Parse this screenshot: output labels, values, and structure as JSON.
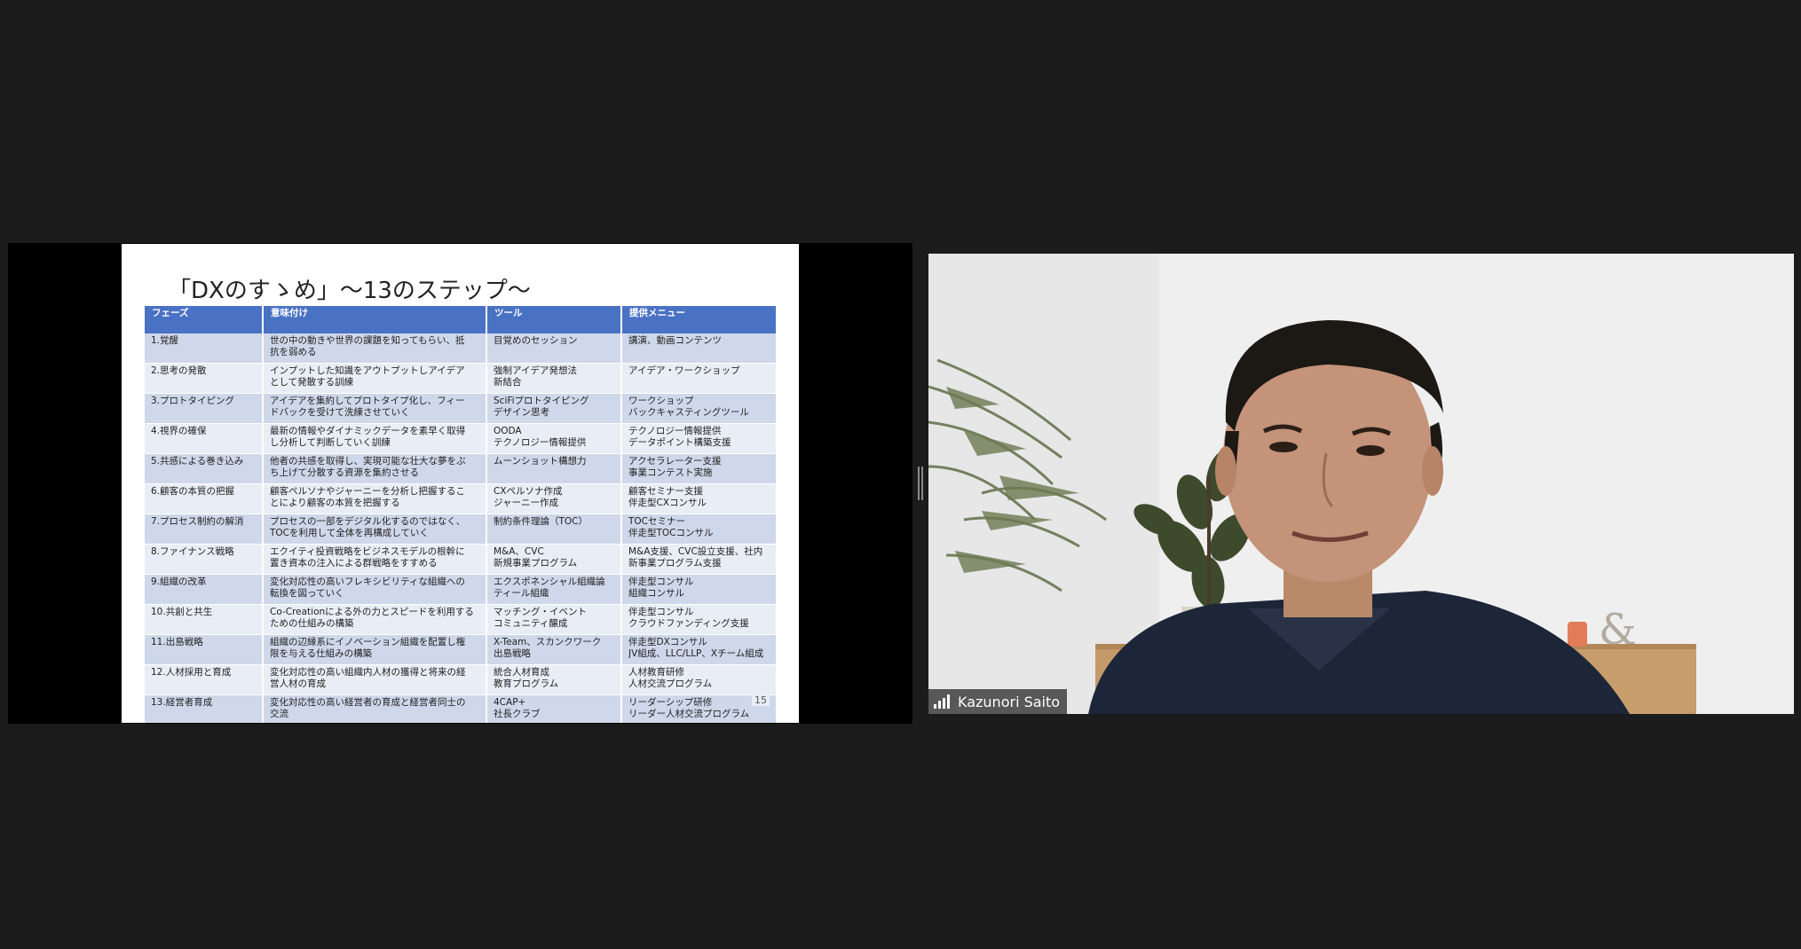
{
  "slide": {
    "title": "「DXのすゝめ」〜13のステップ〜",
    "headers": [
      "フェーズ",
      "意味付け",
      "ツール",
      "提供メニュー"
    ],
    "rows": [
      [
        [
          "1.覚醒"
        ],
        [
          "世の中の動きや世界の課題を知ってもらい、抵",
          "抗を弱める"
        ],
        [
          "目覚めのセッション"
        ],
        [
          "講演、動画コンテンツ"
        ]
      ],
      [
        [
          "2.思考の発散"
        ],
        [
          "インプットした知識をアウトプットしアイデア",
          "として発散する訓練"
        ],
        [
          "強制アイデア発想法",
          "新結合"
        ],
        [
          "アイデア・ワークショップ"
        ]
      ],
      [
        [
          "3.プロトタイピング"
        ],
        [
          "アイデアを集約してプロトタイプ化し、フィー",
          "ドバックを受けて洗練させていく"
        ],
        [
          "SciFiプロトタイピング",
          "デザイン思考"
        ],
        [
          "ワークショップ",
          "バックキャスティングツール"
        ]
      ],
      [
        [
          "4.視界の確保"
        ],
        [
          "最新の情報やダイナミックデータを素早く取得",
          "し分析して判断していく訓練"
        ],
        [
          "OODA",
          "テクノロジー情報提供"
        ],
        [
          "テクノロジー情報提供",
          "データポイント構築支援"
        ]
      ],
      [
        [
          "5.共感による巻き込み"
        ],
        [
          "他者の共感を取得し、実現可能な壮大な夢をぶ",
          "ち上げて分散する資源を集約させる"
        ],
        [
          "ムーンショット構想力"
        ],
        [
          "アクセラレーター支援",
          "事業コンテスト実施"
        ]
      ],
      [
        [
          "6.顧客の本質の把握"
        ],
        [
          "顧客ペルソナやジャーニーを分析し把握するこ",
          "とにより顧客の本質を把握する"
        ],
        [
          "CXペルソナ作成",
          "ジャーニー作成"
        ],
        [
          "顧客セミナー支援",
          "伴走型CXコンサル"
        ]
      ],
      [
        [
          "7.プロセス制約の解消"
        ],
        [
          "プロセスの一部をデジタル化するのではなく、",
          "TOCを利用して全体を再構成していく"
        ],
        [
          "制約条件理論（TOC）"
        ],
        [
          "TOCセミナー",
          "伴走型TOCコンサル"
        ]
      ],
      [
        [
          "8.ファイナンス戦略"
        ],
        [
          "エクイティ投資戦略をビジネスモデルの根幹に",
          "置き資本の注入による群戦略をすすめる"
        ],
        [
          "M&A、CVC",
          "新規事業プログラム"
        ],
        [
          "M&A支援、CVC設立支援、社内",
          "新事業プログラム支援"
        ]
      ],
      [
        [
          "9.組織の改革"
        ],
        [
          "変化対応性の高いフレキシビリティな組織への",
          "転換を図っていく"
        ],
        [
          "エクスポネンシャル組織論",
          "ティール組織"
        ],
        [
          "伴走型コンサル",
          "組織コンサル"
        ]
      ],
      [
        [
          "10.共創と共生"
        ],
        [
          "Co-Creationによる外の力とスピードを利用する",
          "ための仕組みの構築"
        ],
        [
          "マッチング・イベント",
          "コミュニティ醸成"
        ],
        [
          "伴走型コンサル",
          "クラウドファンディング支援"
        ]
      ],
      [
        [
          "11.出島戦略"
        ],
        [
          "組織の辺縁系にイノベーション組織を配置し権",
          "限を与える仕組みの構築"
        ],
        [
          "X-Team、スカンクワーク",
          "出島戦略"
        ],
        [
          "伴走型DXコンサル",
          "JV組成、LLC/LLP、Xチーム組成"
        ]
      ],
      [
        [
          "12.人材採用と育成"
        ],
        [
          "変化対応性の高い組織内人材の獲得と将来の経",
          "営人材の育成"
        ],
        [
          "統合人材育成",
          "教育プログラム"
        ],
        [
          "人材教育研修",
          "人材交流プログラム"
        ]
      ],
      [
        [
          "13.経営者育成"
        ],
        [
          "変化対応性の高い経営者の育成と経営者同士の",
          "交流"
        ],
        [
          "4CAP+",
          "社長クラブ"
        ],
        [
          "リーダーシップ研修",
          "リーダー人材交流プログラム"
        ]
      ]
    ],
    "page_number": "15"
  },
  "participant": {
    "name": "Kazunori Saito"
  },
  "icons": {
    "signal": "signal-strength-icon"
  }
}
